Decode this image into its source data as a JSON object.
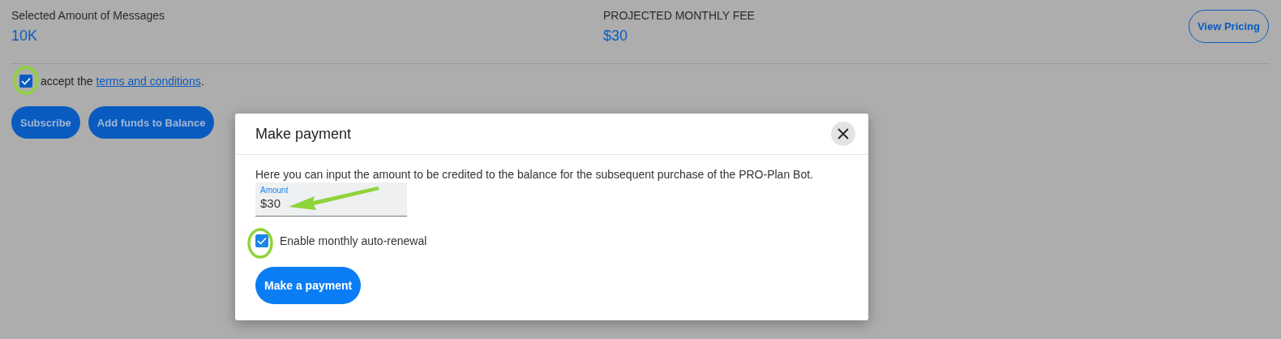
{
  "summary": {
    "messages_label": "Selected Amount of Messages",
    "messages_value": "10K",
    "fee_label": "PROJECTED MONTHLY FEE",
    "fee_value": "$30",
    "pricing_button": "View Pricing"
  },
  "terms": {
    "checked": true,
    "prefix": "accept the ",
    "link": "terms and conditions",
    "suffix": "."
  },
  "actions": [
    "Subscribe",
    "Add funds to Balance"
  ],
  "dialog": {
    "title": "Make payment",
    "description": "Here you can input the amount to be credited to the balance for the subsequent purchase of the PRO-Plan Bot.",
    "amount_label": "Amount",
    "amount_value": "$30",
    "auto_renewal": {
      "label": "Enable monthly auto-renewal",
      "checked": true
    },
    "submit": "Make a payment"
  }
}
